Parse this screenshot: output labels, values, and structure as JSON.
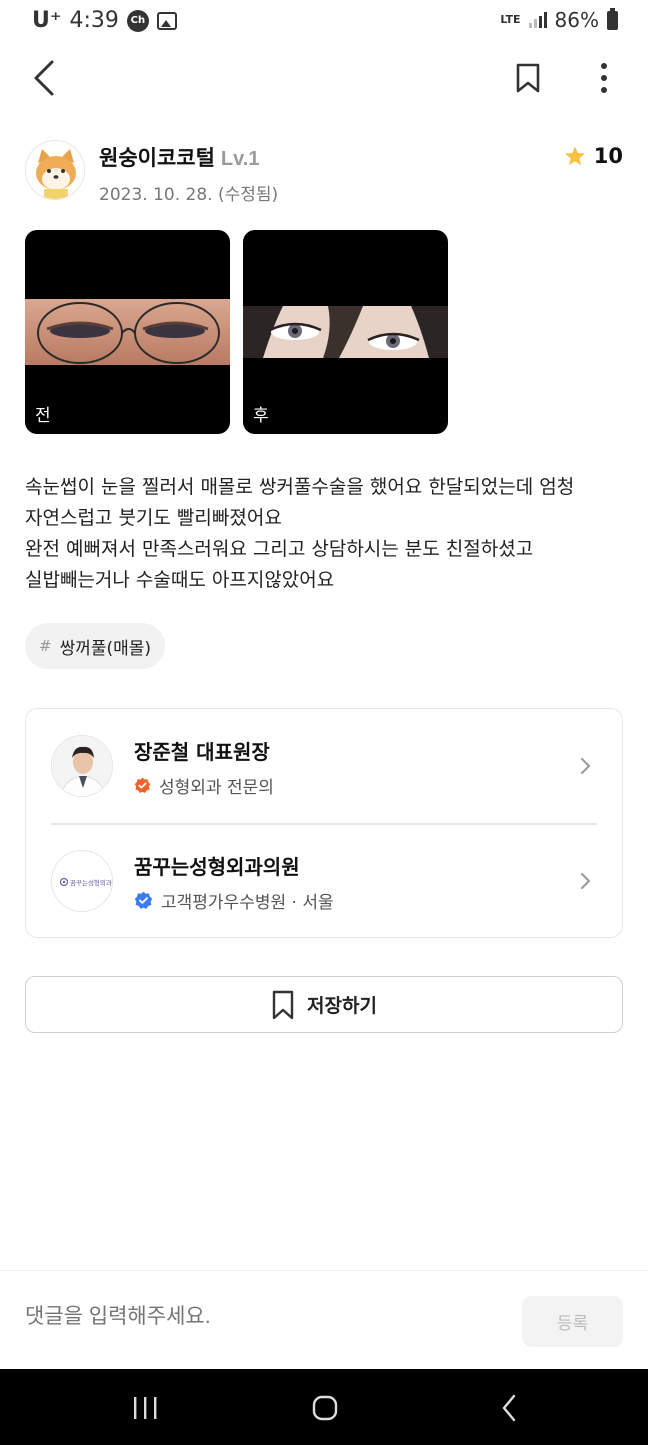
{
  "status_bar": {
    "carrier": "U⁺",
    "time": "4:39",
    "chip": "Ch",
    "network": "LTE",
    "battery": "86%"
  },
  "app_bar": {
    "icons": [
      "back-arrow-icon",
      "bookmark-icon",
      "more-vertical-icon"
    ]
  },
  "author": {
    "name": "원숭이코코털",
    "level": "Lv.1",
    "date": "2023. 10. 28. (수정됨)",
    "rating": "10"
  },
  "photos": [
    {
      "label": "전"
    },
    {
      "label": "후"
    }
  ],
  "review": {
    "lines": [
      "속눈썹이 눈을 찔러서 매몰로 쌍커풀수술을 했어요 한달되었는데 엄청",
      "자연스럽고 붓기도 빨리빠졌어요",
      "완전 예뻐져서 만족스러워요 그리고 상담하시는 분도 친절하셨고",
      "실밥빼는거나 수술때도 아프지않았어요"
    ]
  },
  "tag": {
    "hash": "#",
    "label": "쌍꺼풀(매몰)"
  },
  "doctor": {
    "name": "장준철 대표원장",
    "specialty": "성형외과 전문의"
  },
  "hospital": {
    "name": "꿈꾸는성형외과의원",
    "logo_text": "꿈꾸는성형외과",
    "badge": "고객평가우수병원 · 서울"
  },
  "save_button": {
    "label": "저장하기"
  },
  "comment": {
    "placeholder": "댓글을 입력해주세요.",
    "submit_label": "등록"
  },
  "colors": {
    "star": "#f5c242",
    "specialist_badge": "#f0642a",
    "verified_badge": "#3d7bf0"
  }
}
